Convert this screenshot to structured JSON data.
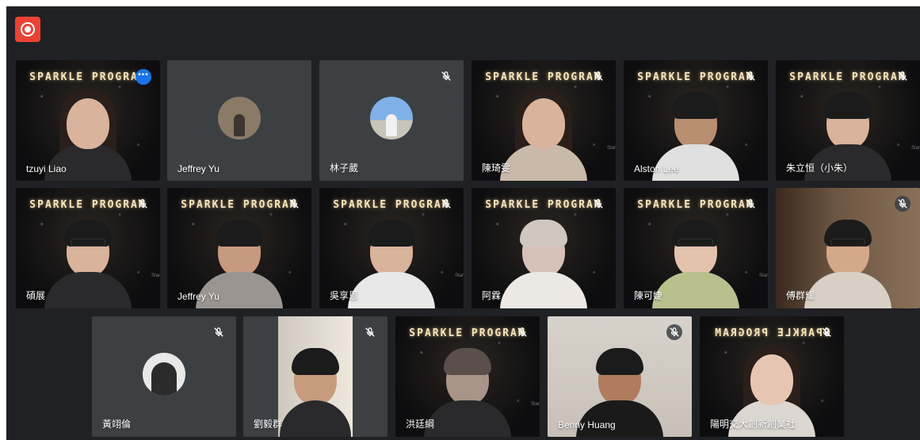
{
  "toolbar": {
    "record_icon": "record-icon"
  },
  "banner": "SPARKLE PROGRAM",
  "corner_tag": "Star",
  "icons": {
    "muted": "mic-off-icon",
    "more": "more-options-icon"
  },
  "participants": [
    {
      "name": "tzuyi Liao",
      "video": true,
      "active_speaker": true,
      "muted": false
    },
    {
      "name": "Jeffrey Yu",
      "video": false,
      "muted": false
    },
    {
      "name": "林子葳",
      "video": false,
      "muted": true
    },
    {
      "name": "陳琦雯",
      "video": true,
      "muted": true
    },
    {
      "name": "Alston Lee",
      "video": true,
      "muted": true
    },
    {
      "name": "朱立恒（小朱）",
      "video": true,
      "muted": true
    },
    {
      "name": "碩展",
      "video": true,
      "muted": true
    },
    {
      "name": "Jeffrey Yu",
      "video": true,
      "muted": true
    },
    {
      "name": "吳享恩",
      "video": true,
      "muted": true
    },
    {
      "name": "阿霖",
      "video": true,
      "muted": true
    },
    {
      "name": "陳可婕",
      "video": true,
      "muted": true
    },
    {
      "name": "傅群耀",
      "video": true,
      "muted": true
    },
    {
      "name": "黃翊倫",
      "video": false,
      "muted": true
    },
    {
      "name": "劉毅群",
      "video": true,
      "muted": true
    },
    {
      "name": "洪廷綱",
      "video": true,
      "muted": true
    },
    {
      "name": "Benny Huang",
      "video": true,
      "muted": true
    },
    {
      "name": "陽明交大創新創業社",
      "video": true,
      "muted": true
    }
  ]
}
